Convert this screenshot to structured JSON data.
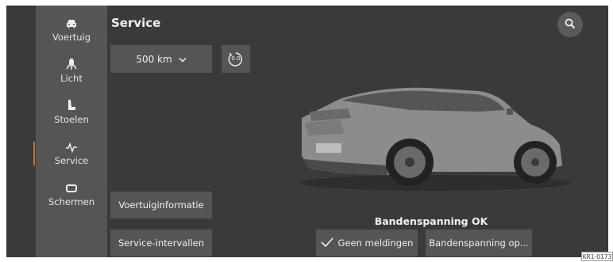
{
  "sidebar": {
    "items": [
      {
        "label": "Voertuig",
        "icon": "car-icon"
      },
      {
        "label": "Licht",
        "icon": "light-icon"
      },
      {
        "label": "Stoelen",
        "icon": "seat-icon"
      },
      {
        "label": "Service",
        "icon": "service-pulse-icon",
        "active": true
      },
      {
        "label": "Schermen",
        "icon": "screen-icon"
      }
    ]
  },
  "header": {
    "title": "Service",
    "search_icon": "search-icon"
  },
  "controls": {
    "distance_value": "500 km",
    "distance_icon": "chevron-down-icon",
    "reset_icon": "trip-reset-icon",
    "reset_label": "0.0"
  },
  "buttons": {
    "vehicle_info": "Voertuiginformatie",
    "service_intervals": "Service-intervallen",
    "no_notifications": "Geen meldingen",
    "tire_pressure": "Bandenspanning op..."
  },
  "status": {
    "tire_status": "Bandenspanning OK"
  },
  "colors": {
    "accent": "#c46f38",
    "background": "#3a3a3a",
    "panel": "#555555"
  },
  "watermark": "KR1-0173"
}
